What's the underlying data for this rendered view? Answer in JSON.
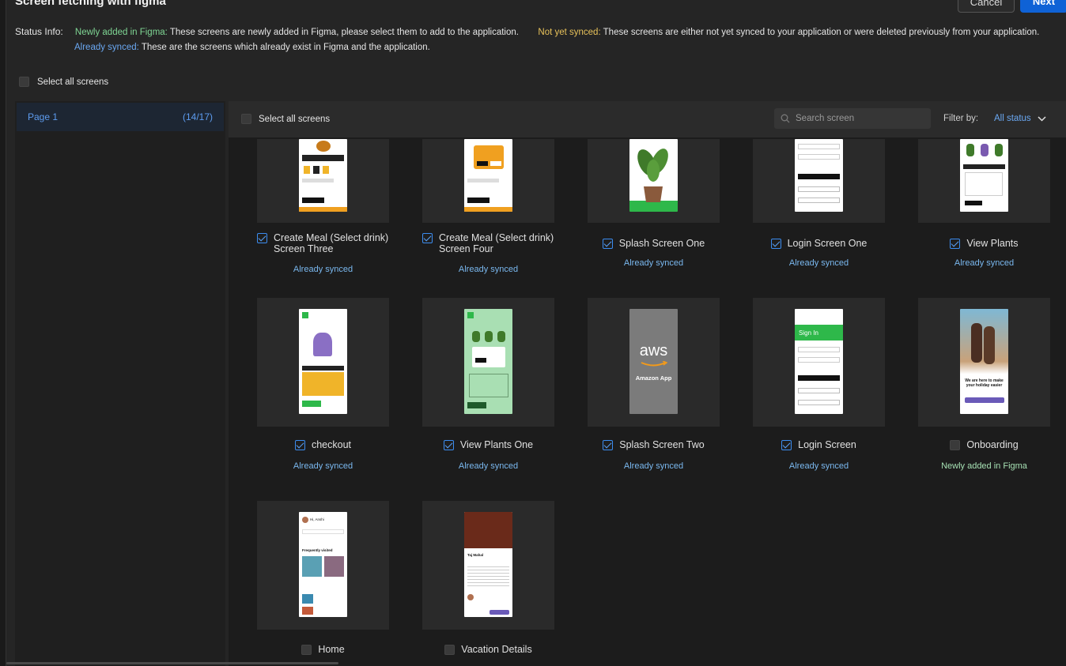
{
  "modal": {
    "title": "Screen fetching with figma",
    "cancel_label": "Cancel",
    "next_label": "Next"
  },
  "status_info": {
    "label": "Status Info:",
    "newly_title": "Newly added in Figma:",
    "newly_text": "These screens are newly added in Figma, please select them to add to the application.",
    "notsynced_title": "Not yet synced:",
    "notsynced_text": "These screens are either not yet synced to your application or were deleted previously from your application.",
    "synced_title": "Already synced:",
    "synced_text": "These are the screens which already exist in Figma and the application."
  },
  "top_select_all": "Select all screens",
  "sidebar": {
    "pages": [
      {
        "label": "Page 1",
        "count": "(14/17)"
      }
    ]
  },
  "content_header": {
    "select_all": "Select all screens",
    "search_placeholder": "Search screen",
    "filter_label": "Filter by:",
    "filter_value": "All status"
  },
  "screens": [
    {
      "name": "Create Meal (Select drink) Screen Three",
      "checked": true,
      "status": "Already synced",
      "thumb": "meal"
    },
    {
      "name": "Create Meal (Select drink) Screen Four",
      "checked": true,
      "status": "Already synced",
      "thumb": "meal2"
    },
    {
      "name": "Splash Screen One",
      "checked": true,
      "status": "Already synced",
      "thumb": "plant"
    },
    {
      "name": "Login Screen One",
      "checked": true,
      "status": "Already synced",
      "thumb": "login1"
    },
    {
      "name": "View Plants",
      "checked": true,
      "status": "Already synced",
      "thumb": "viewplants"
    },
    {
      "name": "checkout",
      "checked": true,
      "status": "Already synced",
      "thumb": "checkout"
    },
    {
      "name": "View Plants One",
      "checked": true,
      "status": "Already synced",
      "thumb": "viewplants1"
    },
    {
      "name": "Splash Screen Two",
      "checked": true,
      "status": "Already synced",
      "thumb": "aws"
    },
    {
      "name": "Login Screen",
      "checked": true,
      "status": "Already synced",
      "thumb": "login"
    },
    {
      "name": "Onboarding",
      "checked": false,
      "status": "Newly added in Figma",
      "thumb": "onboarding"
    },
    {
      "name": "Home",
      "checked": false,
      "status": "",
      "thumb": "home"
    },
    {
      "name": "Vacation Details",
      "checked": false,
      "status": "",
      "thumb": "vacation"
    }
  ],
  "thumb_text": {
    "aws_logo": "aws",
    "aws_app": "Amazon App",
    "sign_in": "Sign In",
    "onboarding_headline": "We are here to make your holiday easier",
    "home_greeting": "Hi, Anshi",
    "home_section": "Frequently visited",
    "vacation_title": "Taj Mahal"
  },
  "colors": {
    "accent_blue": "#0f62d6",
    "synced": "#7ab8ef",
    "newly": "#a6e0b3",
    "notsynced": "#e8c25a"
  }
}
